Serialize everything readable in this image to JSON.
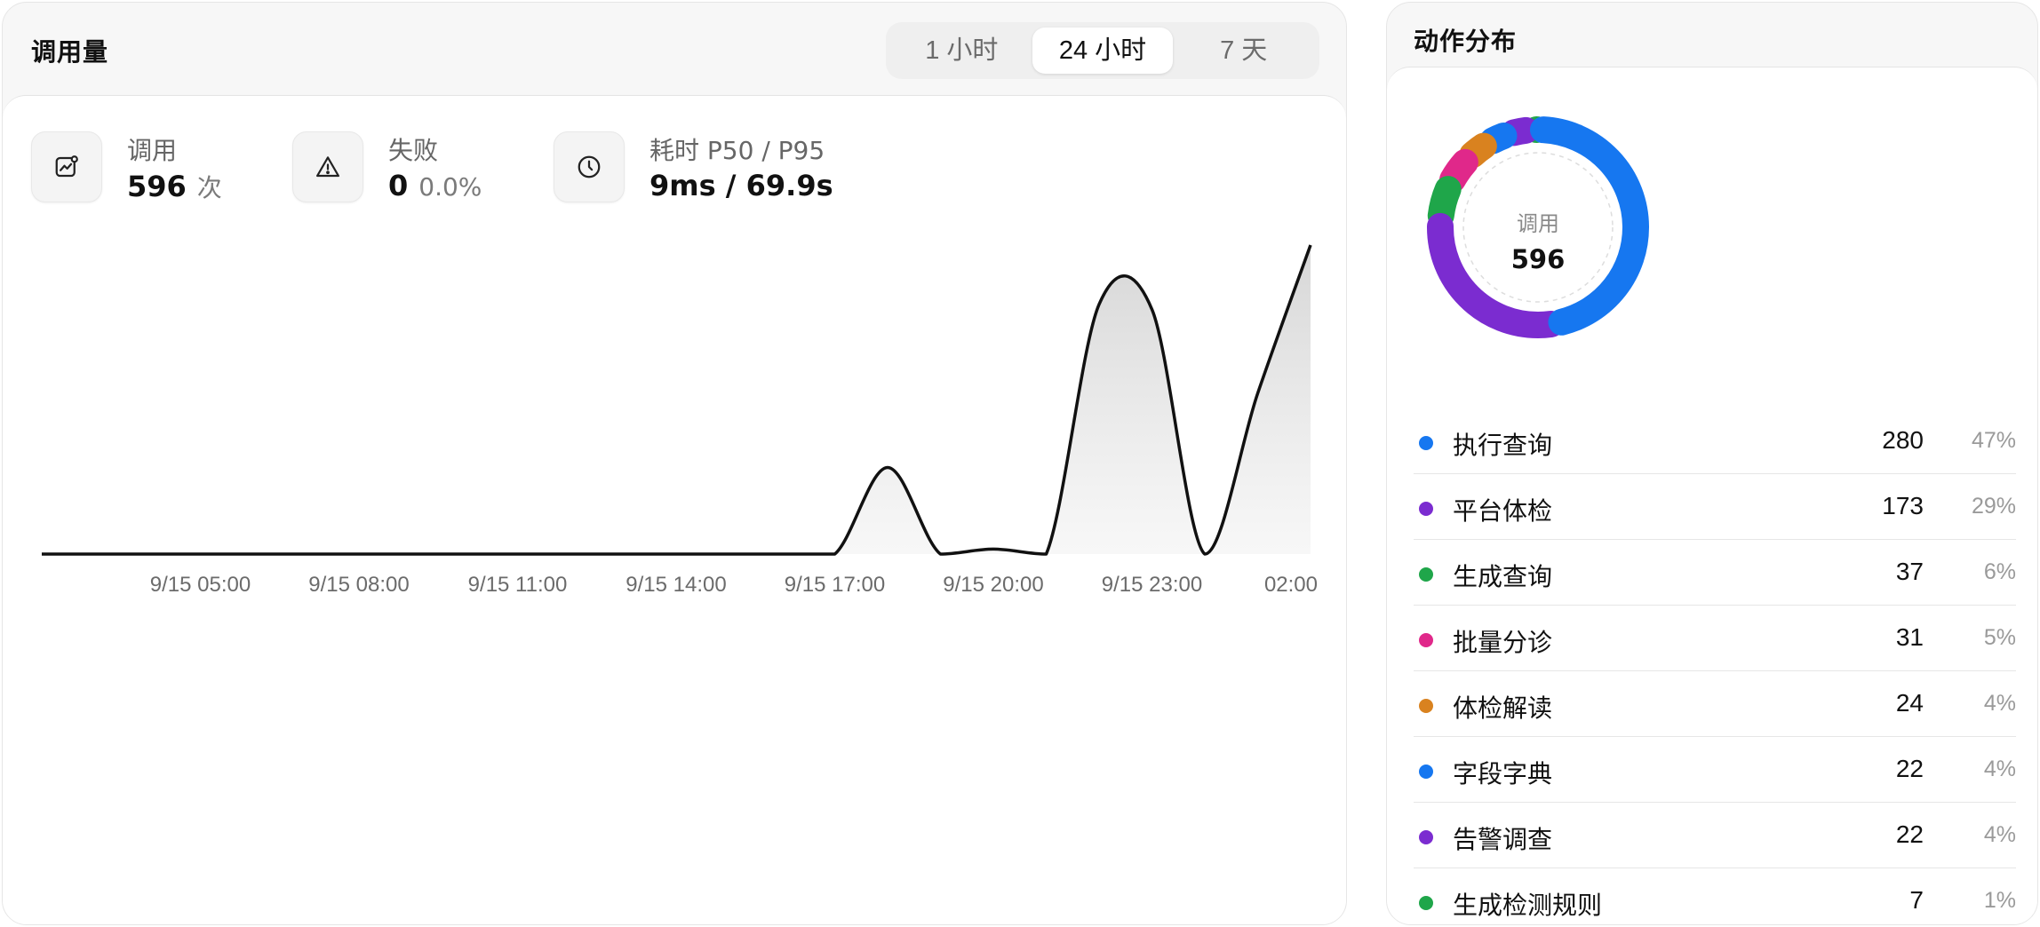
{
  "usage": {
    "title": "调用量",
    "ranges": [
      "1 小时",
      "24 小时",
      "7 天"
    ],
    "active_range": 1,
    "stats": {
      "calls": {
        "label": "调用",
        "value": "596",
        "unit": "次"
      },
      "failures": {
        "label": "失败",
        "value": "0",
        "rate": "0.0%"
      },
      "latency": {
        "label": "耗时 P50 / P95",
        "value": "9ms / 69.9s"
      }
    }
  },
  "distribution": {
    "title": "动作分布",
    "center_label": "调用",
    "center_value": "596",
    "items": [
      {
        "name": "执行查询",
        "count": "280",
        "pct": "47%",
        "color": "#1677f0"
      },
      {
        "name": "平台体检",
        "count": "173",
        "pct": "29%",
        "color": "#7b2cd0"
      },
      {
        "name": "生成查询",
        "count": "37",
        "pct": "6%",
        "color": "#1fa64a"
      },
      {
        "name": "批量分诊",
        "count": "31",
        "pct": "5%",
        "color": "#e0288a"
      },
      {
        "name": "体检解读",
        "count": "24",
        "pct": "4%",
        "color": "#d9821f"
      },
      {
        "name": "字段字典",
        "count": "22",
        "pct": "4%",
        "color": "#1677f0"
      },
      {
        "name": "告警调查",
        "count": "22",
        "pct": "4%",
        "color": "#7b2cd0"
      },
      {
        "name": "生成检测规则",
        "count": "7",
        "pct": "1%",
        "color": "#1fa64a"
      }
    ]
  },
  "chart_data": [
    {
      "type": "area",
      "title": "",
      "xlabel": "",
      "ylabel": "",
      "x_ticks": [
        "9/15 05:00",
        "9/15 08:00",
        "9/15 11:00",
        "9/15 14:00",
        "9/15 17:00",
        "9/15 20:00",
        "9/15 23:00",
        "02:00"
      ],
      "x": [
        "9/15 02:00",
        "9/15 03:00",
        "9/15 04:00",
        "9/15 05:00",
        "9/15 06:00",
        "9/15 07:00",
        "9/15 08:00",
        "9/15 09:00",
        "9/15 10:00",
        "9/15 11:00",
        "9/15 12:00",
        "9/15 13:00",
        "9/15 14:00",
        "9/15 15:00",
        "9/15 16:00",
        "9/15 17:00",
        "9/15 18:00",
        "9/15 19:00",
        "9/15 20:00",
        "9/15 21:00",
        "9/15 22:00",
        "9/15 23:00",
        "9/16 00:00",
        "9/16 01:00",
        "9/16 02:00"
      ],
      "series": [
        {
          "values": [
            0,
            0,
            0,
            0,
            0,
            0,
            0,
            0,
            0,
            0,
            0,
            0,
            0,
            0,
            0,
            0,
            35,
            0,
            2,
            0,
            101,
            99,
            0,
            65,
            125
          ]
        }
      ],
      "ylim": [
        0,
        125
      ],
      "grid": false,
      "color": "#111111"
    },
    {
      "type": "pie",
      "donut": true,
      "categories": [
        "执行查询",
        "平台体检",
        "生成查询",
        "批量分诊",
        "体检解读",
        "字段字典",
        "告警调查",
        "生成检测规则"
      ],
      "values": [
        280,
        173,
        37,
        31,
        24,
        22,
        22,
        7
      ],
      "colors": [
        "#1677f0",
        "#7b2cd0",
        "#1fa64a",
        "#e0288a",
        "#d9821f",
        "#1677f0",
        "#7b2cd0",
        "#1fa64a"
      ]
    }
  ]
}
